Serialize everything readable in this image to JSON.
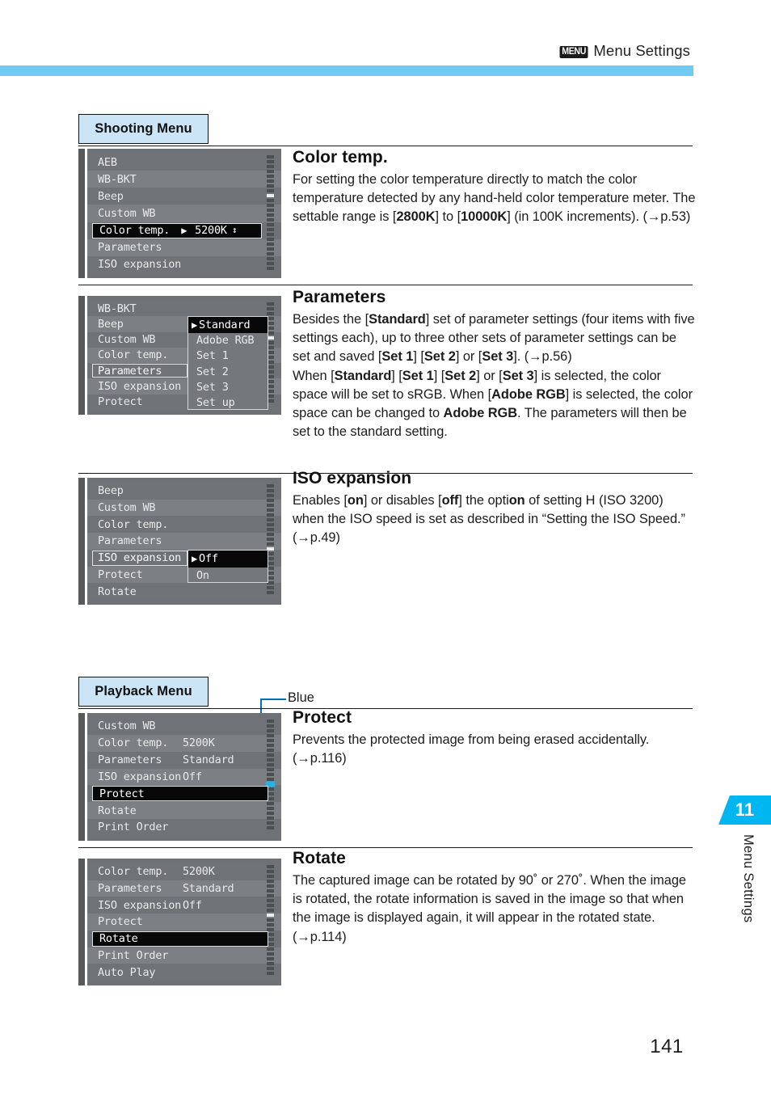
{
  "header": {
    "menu_glyph": "MENU",
    "title": "Menu Settings"
  },
  "badges": {
    "shooting": "Shooting Menu",
    "playback": "Playback Menu"
  },
  "callout": {
    "label": "Blue"
  },
  "side_tab": {
    "number": "11",
    "label": "Menu Settings"
  },
  "page_number": "141",
  "colors": {
    "header_bar": "#71cbee",
    "badge_fill": "#cce5f6",
    "tab_fill": "#00b6f0",
    "callout_blue": "#0072bc",
    "lcd_bg": "#6e7175",
    "lcd_highlight": "#080808"
  },
  "entries": [
    {
      "id": "color-temp",
      "heading": "Color temp.",
      "body": "For setting the color temperature directly to match the color temperature detected by any hand-held color temperature meter. The settable range is [2800K] to [10000K] (in 100K increments). (→p.53)",
      "bold_terms": [
        "2800K",
        "10000K"
      ],
      "screen": {
        "rows": [
          {
            "label": "AEB",
            "value": ""
          },
          {
            "label": "WB-BKT",
            "value": ""
          },
          {
            "label": "Beep",
            "value": ""
          },
          {
            "label": "Custom WB",
            "value": ""
          },
          {
            "label": "Color temp.",
            "value": "",
            "selected": true
          },
          {
            "label": "Parameters",
            "value": ""
          },
          {
            "label": "ISO expansion",
            "value": ""
          }
        ],
        "highlight": {
          "label": "Color temp.",
          "caret": "▶",
          "value": "5200K",
          "updown": "↕"
        },
        "scroll_thumb_index": 2
      }
    },
    {
      "id": "parameters",
      "heading": "Parameters",
      "body": "Besides the [Standard] set of parameter settings (four items with five settings each), up to three other sets of parameter settings can be set and saved [Set 1] [Set 2] or [Set 3]. (→p.56)",
      "body2": "When [Standard] [Set 1] [Set 2] or [Set 3] is selected, the color space will be set to sRGB. When [Adobe RGB] is selected, the color space can be changed to Adobe RGB. The parameters will then be set to the standard setting.",
      "bold_terms": [
        "Standard",
        "Set 1",
        "Set 2",
        "Set 3",
        "Adobe RGB"
      ],
      "screen": {
        "rows": [
          {
            "label": "WB-BKT",
            "value": ""
          },
          {
            "label": "Beep",
            "value": ""
          },
          {
            "label": "Custom WB",
            "value": ""
          },
          {
            "label": "Color temp.",
            "value": ""
          },
          {
            "label": "Parameters",
            "value": "",
            "outlined": true
          },
          {
            "label": "ISO expansion",
            "value": ""
          },
          {
            "label": "Protect",
            "value": ""
          }
        ],
        "submenu": {
          "items": [
            {
              "label": "Standard",
              "selected": true,
              "caret": "▶"
            },
            {
              "label": "Adobe RGB",
              "selected": false
            },
            {
              "label": "Set 1",
              "selected": false
            },
            {
              "label": "Set 2",
              "selected": false
            },
            {
              "label": "Set 3",
              "selected": false
            },
            {
              "label": "Set up",
              "selected": false
            }
          ]
        },
        "scroll_thumb_index": 2
      }
    },
    {
      "id": "iso-expansion",
      "heading": "ISO expansion",
      "body": "Enables [on] or disables [off] the option of setting H (ISO 3200) when the ISO speed is set as described in “Setting the ISO Speed.” (→p.49)",
      "bold_terms": [
        "on",
        "off"
      ],
      "screen": {
        "rows": [
          {
            "label": "Beep",
            "value": ""
          },
          {
            "label": "Custom WB",
            "value": ""
          },
          {
            "label": "Color temp.",
            "value": ""
          },
          {
            "label": "Parameters",
            "value": ""
          },
          {
            "label": "ISO expansion",
            "value": "",
            "outlined": true
          },
          {
            "label": "Protect",
            "value": ""
          },
          {
            "label": "Rotate",
            "value": ""
          }
        ],
        "submenu": {
          "items": [
            {
              "label": "Off",
              "selected": true,
              "caret": "▶"
            },
            {
              "label": "On",
              "selected": false
            }
          ]
        },
        "scroll_thumb_index": 4
      }
    },
    {
      "id": "protect",
      "heading": "Protect",
      "body": "Prevents the protected image from being erased accidentally. (→p.116)",
      "bold_terms": [],
      "screen": {
        "rows": [
          {
            "label": "Custom WB",
            "value": ""
          },
          {
            "label": "Color temp.",
            "value": "5200K"
          },
          {
            "label": "Parameters",
            "value": "Standard"
          },
          {
            "label": "ISO expansion",
            "value": "Off"
          },
          {
            "label": "Protect",
            "value": "",
            "selected": true
          },
          {
            "label": "Rotate",
            "value": ""
          },
          {
            "label": "Print Order",
            "value": ""
          }
        ],
        "highlight": {
          "label": "Protect",
          "caret": "",
          "value": "",
          "updown": ""
        },
        "scroll_thumb_index": 4,
        "scroll_thumb_blue": true
      }
    },
    {
      "id": "rotate",
      "heading": "Rotate",
      "body": "The captured image can be rotated by 90˚ or 270˚. When the image is rotated, the rotate information is saved in the image so that when the image is displayed again, it will appear in the rotated state. (→p.114)",
      "bold_terms": [],
      "screen": {
        "rows": [
          {
            "label": "Color temp.",
            "value": "5200K"
          },
          {
            "label": "Parameters",
            "value": "Standard"
          },
          {
            "label": "ISO expansion",
            "value": "Off"
          },
          {
            "label": "Protect",
            "value": ""
          },
          {
            "label": "Rotate",
            "value": "",
            "selected": true
          },
          {
            "label": "Print Order",
            "value": ""
          },
          {
            "label": "Auto Play",
            "value": ""
          }
        ],
        "highlight": {
          "label": "Rotate",
          "caret": "",
          "value": "",
          "updown": ""
        },
        "scroll_thumb_index": 3
      }
    }
  ]
}
